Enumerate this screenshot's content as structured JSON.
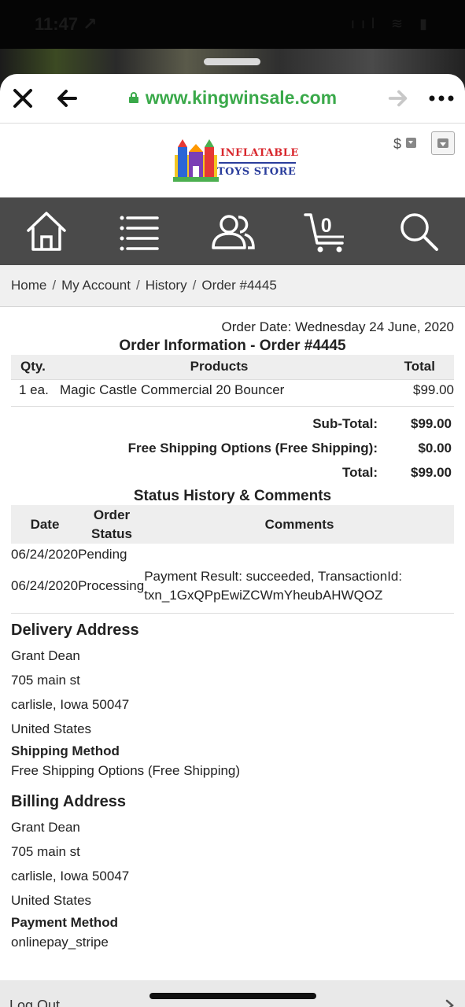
{
  "status_bar": {
    "time": "11:47 ↗",
    "icons": "ııl ≋ ▮"
  },
  "browser": {
    "url": "www.kingwinsale.com",
    "accent": "#3aa94a",
    "close_icon": "close-icon",
    "back_icon": "arrow-left-icon",
    "forward_icon": "arrow-right-icon",
    "more_icon": "more-icon"
  },
  "header": {
    "logo_line1": "INFLATABLE",
    "logo_line2": "TOYS STORE",
    "currency_symbol": "$"
  },
  "nav": {
    "background": "#4a4a4a",
    "items": [
      "home-icon",
      "menu-list-icon",
      "account-icon",
      "cart-icon",
      "search-icon"
    ],
    "cart_count": "0"
  },
  "breadcrumb": {
    "items": [
      "Home",
      "My Account",
      "History",
      "Order #4445"
    ],
    "separator": "/"
  },
  "order": {
    "date_text": "Order Date: Wednesday 24 June, 2020",
    "title": "Order Information - Order #4445",
    "columns": [
      "Qty.",
      "Products",
      "Total"
    ],
    "items": [
      {
        "qty": "1 ea.",
        "product": "Magic Castle Commercial 20 Bouncer",
        "total": "$99.00"
      }
    ],
    "totals": [
      {
        "label": "Sub-Total:",
        "value": "$99.00"
      },
      {
        "label": "Free Shipping Options (Free Shipping):",
        "value": "$0.00"
      },
      {
        "label": "Total:",
        "value": "$99.00"
      }
    ]
  },
  "history": {
    "title": "Status History & Comments",
    "columns": {
      "date": "Date",
      "status_line1": "Order",
      "status_line2": "Status",
      "comments": "Comments"
    },
    "rows": [
      {
        "date": "06/24/2020",
        "status": "Pending",
        "comment_line1": "",
        "comment_line2": ""
      },
      {
        "date": "06/24/2020",
        "status": "Processing",
        "comment_line1": "Payment Result: succeeded, TransactionId:",
        "comment_line2": "txn_1GxQPpEwiZCWmYheubAHWQOZ"
      }
    ]
  },
  "delivery": {
    "title": "Delivery Address",
    "lines": [
      "Grant Dean",
      "705 main st",
      "carlisle, Iowa 50047",
      "United States"
    ],
    "method_label": "Shipping Method",
    "method_value": "Free Shipping Options (Free Shipping)"
  },
  "billing": {
    "title": "Billing Address",
    "lines": [
      "Grant Dean",
      "705 main st",
      "carlisle, Iowa 50047",
      "United States"
    ],
    "method_label": "Payment Method",
    "method_value": "onlinepay_stripe"
  },
  "footer": {
    "logout": "Log Out"
  }
}
